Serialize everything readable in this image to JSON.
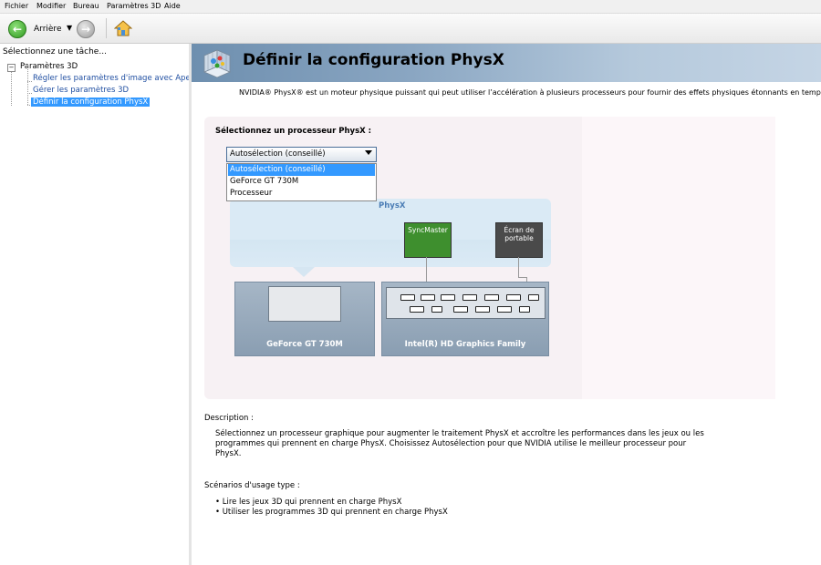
{
  "menu": [
    "Fichier",
    "Modifier",
    "Bureau",
    "Paramètres 3D",
    "Aide"
  ],
  "toolbar": {
    "back_label": "Arrière",
    "dropdown": "▼"
  },
  "left_pane": {
    "title": "Sélectionnez une tâche...",
    "root": "Paramètres 3D",
    "items": [
      "Régler les paramètres d'image avec Aperçu",
      "Gérer les paramètres 3D",
      "Définir la configuration PhysX"
    ]
  },
  "page": {
    "title": "Définir la configuration PhysX",
    "intro": "NVIDIA® PhysX® est un moteur physique puissant qui peut utiliser l’accélération à plusieurs processeurs pour fournir des effets physiques étonnants en temps réel."
  },
  "processor": {
    "label": "Sélectionnez un processeur PhysX :",
    "selected": "Autosélection (conseillé)",
    "options": [
      "Autosélection (conseillé)",
      "GeForce GT 730M",
      "Processeur"
    ]
  },
  "diagram": {
    "physx_label": "PhysX",
    "monitor_1": "SyncMaster",
    "monitor_2_line1": "Écran de",
    "monitor_2_line2": "portable",
    "gpu_1": "GeForce GT 730M",
    "gpu_2": "Intel(R) HD Graphics Family"
  },
  "description": {
    "heading": "Description :",
    "body": "Sélectionnez un processeur graphique pour augmenter le traitement PhysX et accroître les performances dans les jeux ou les programmes qui prennent en charge PhysX. Choisissez Autosélection pour que NVIDIA utilise le meilleur processeur pour PhysX."
  },
  "scenarios": {
    "heading": "Scénarios d'usage type :",
    "items": [
      "• Lire les jeux 3D qui prennent en charge PhysX",
      "• Utiliser les programmes 3D qui prennent en charge PhysX"
    ]
  },
  "colors": {
    "accent": "#3399ff",
    "gpu_card": "#98abbf",
    "physx_area": "#daeaf5",
    "monitor_green": "#3e8f2e"
  }
}
